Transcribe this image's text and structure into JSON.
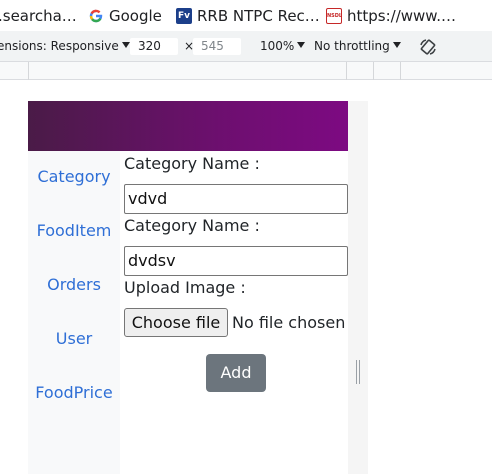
{
  "bookmarks": [
    {
      "label": ".searcha…",
      "icon": "globe-icon"
    },
    {
      "label": "Google",
      "icon": "google-icon"
    },
    {
      "label": "RRB NTPC Rec…",
      "icon": "fv-icon"
    },
    {
      "label": "https://www.…",
      "icon": "nsdl-icon"
    }
  ],
  "devtools": {
    "dimensions_label": "ensions: Responsive",
    "width_value": "320",
    "times": "×",
    "height_value": "545",
    "zoom": "100%",
    "throttling": "No throttling",
    "rotate_icon": "rotate-icon"
  },
  "app": {
    "nav": [
      "Category",
      "FoodItem",
      "Orders",
      "User",
      "FoodPrice"
    ],
    "form": {
      "label1": "Category Name :",
      "value1": "vdvd",
      "label2": "Category Name :",
      "value2": "dvdsv",
      "upload_label": "Upload Image :",
      "choose_file": "Choose file",
      "file_status": "No file chosen",
      "add_button": "Add"
    }
  },
  "colors": {
    "header_gradient_start": "#4a1b47",
    "header_gradient_end": "#7d0a82",
    "nav_link": "#2f6fd6",
    "add_button": "#6c757d"
  }
}
